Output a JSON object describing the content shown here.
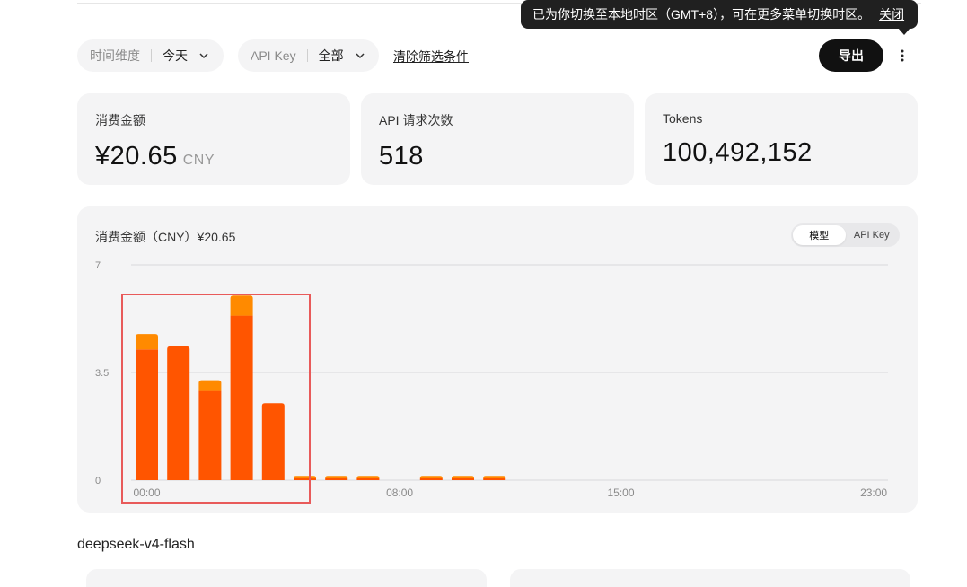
{
  "filters": {
    "time": {
      "label": "时间维度",
      "value": "今天"
    },
    "api_key": {
      "label": "API Key",
      "value": "全部"
    },
    "clear_label": "清除筛选条件"
  },
  "toolbar": {
    "export_label": "导出"
  },
  "tooltip": {
    "text": "已为你切换至本地时区（GMT+8），可在更多菜单切换时区。",
    "close_label": "关闭"
  },
  "stats": [
    {
      "label": "消费金额",
      "value": "¥20.65",
      "unit": "CNY"
    },
    {
      "label": "API 请求次数",
      "value": "518",
      "unit": ""
    },
    {
      "label": "Tokens",
      "value": "100,492,152",
      "unit": ""
    }
  ],
  "chart_card": {
    "title": "消费金额（CNY）¥20.65",
    "toggle": [
      "模型",
      "API Key"
    ],
    "active_toggle": "模型"
  },
  "chart_data": {
    "type": "bar",
    "stacked": true,
    "y_ticks": [
      "7",
      "3.5",
      "0"
    ],
    "x_tick_labels": [
      {
        "label": "00:00",
        "hour": 0
      },
      {
        "label": "08:00",
        "hour": 8
      },
      {
        "label": "15:00",
        "hour": 15
      },
      {
        "label": "23:00",
        "hour": 23
      }
    ],
    "ylim": [
      0,
      7
    ],
    "grid": true,
    "hours": [
      0,
      1,
      2,
      3,
      4,
      5,
      6,
      7,
      8,
      9,
      10,
      11,
      12,
      13,
      14,
      15,
      16,
      17,
      18,
      19,
      20,
      21,
      22,
      23
    ],
    "series": [
      {
        "values": [
          4.25,
          4.35,
          2.9,
          5.35,
          2.5,
          0.06,
          0.06,
          0.06,
          0,
          0.06,
          0.06,
          0.06,
          0,
          0,
          0,
          0,
          0,
          0,
          0,
          0,
          0,
          0,
          0,
          0
        ],
        "color": "#ff5500"
      },
      {
        "values": [
          0.5,
          0,
          0.35,
          0.65,
          0,
          0.08,
          0.08,
          0.08,
          0,
          0.08,
          0.08,
          0.08,
          0,
          0,
          0,
          0,
          0,
          0,
          0,
          0,
          0,
          0,
          0,
          0
        ],
        "color": "#ff8a00"
      }
    ]
  },
  "model_section": {
    "heading": "deepseek-v4-flash"
  }
}
